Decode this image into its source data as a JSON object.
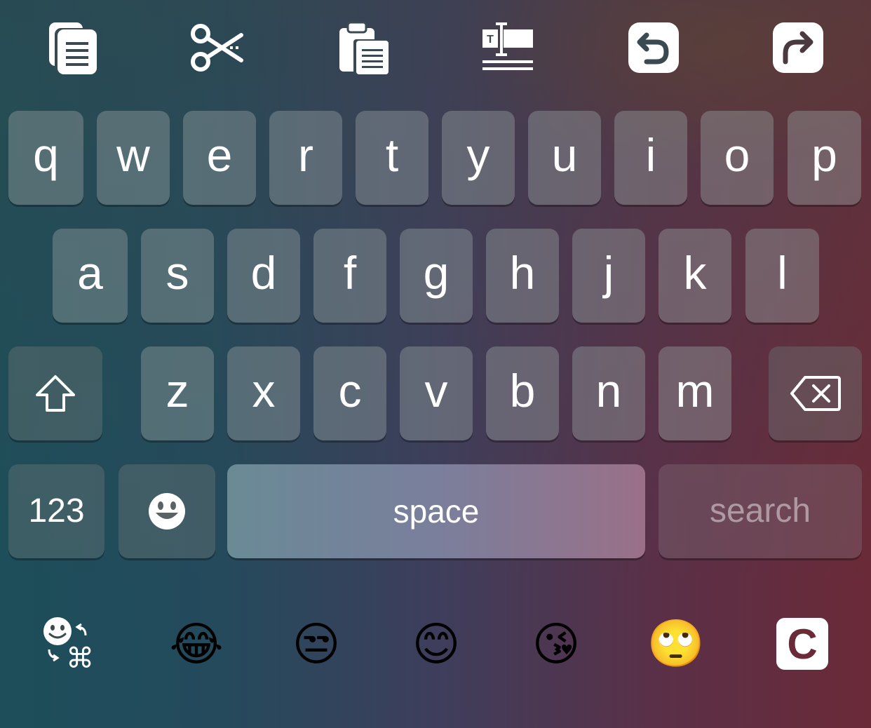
{
  "toolbar": {
    "icons": [
      "copy-icon",
      "cut-icon",
      "paste-icon",
      "select-text-icon",
      "undo-icon",
      "redo-icon"
    ]
  },
  "keyboard": {
    "row1": [
      "q",
      "w",
      "e",
      "r",
      "t",
      "y",
      "u",
      "i",
      "o",
      "p"
    ],
    "row2": [
      "a",
      "s",
      "d",
      "f",
      "g",
      "h",
      "j",
      "k",
      "l"
    ],
    "row3": [
      "z",
      "x",
      "c",
      "v",
      "b",
      "n",
      "m"
    ],
    "shift_icon": "shift-arrow-icon",
    "delete_icon": "backspace-icon",
    "numbers_label": "123",
    "emoji_icon": "smiley-icon",
    "space_label": "space",
    "search_label": "search"
  },
  "bottom_bar": {
    "switcher_icon": "emoji-command-switch-icon",
    "emoji": [
      "😂",
      "😒",
      "😊",
      "😘",
      "🙄"
    ],
    "app_icon_letter": "C",
    "colors": {
      "app_icon_bg": "#ffffff",
      "app_icon_fg": "#6b2a38"
    }
  }
}
